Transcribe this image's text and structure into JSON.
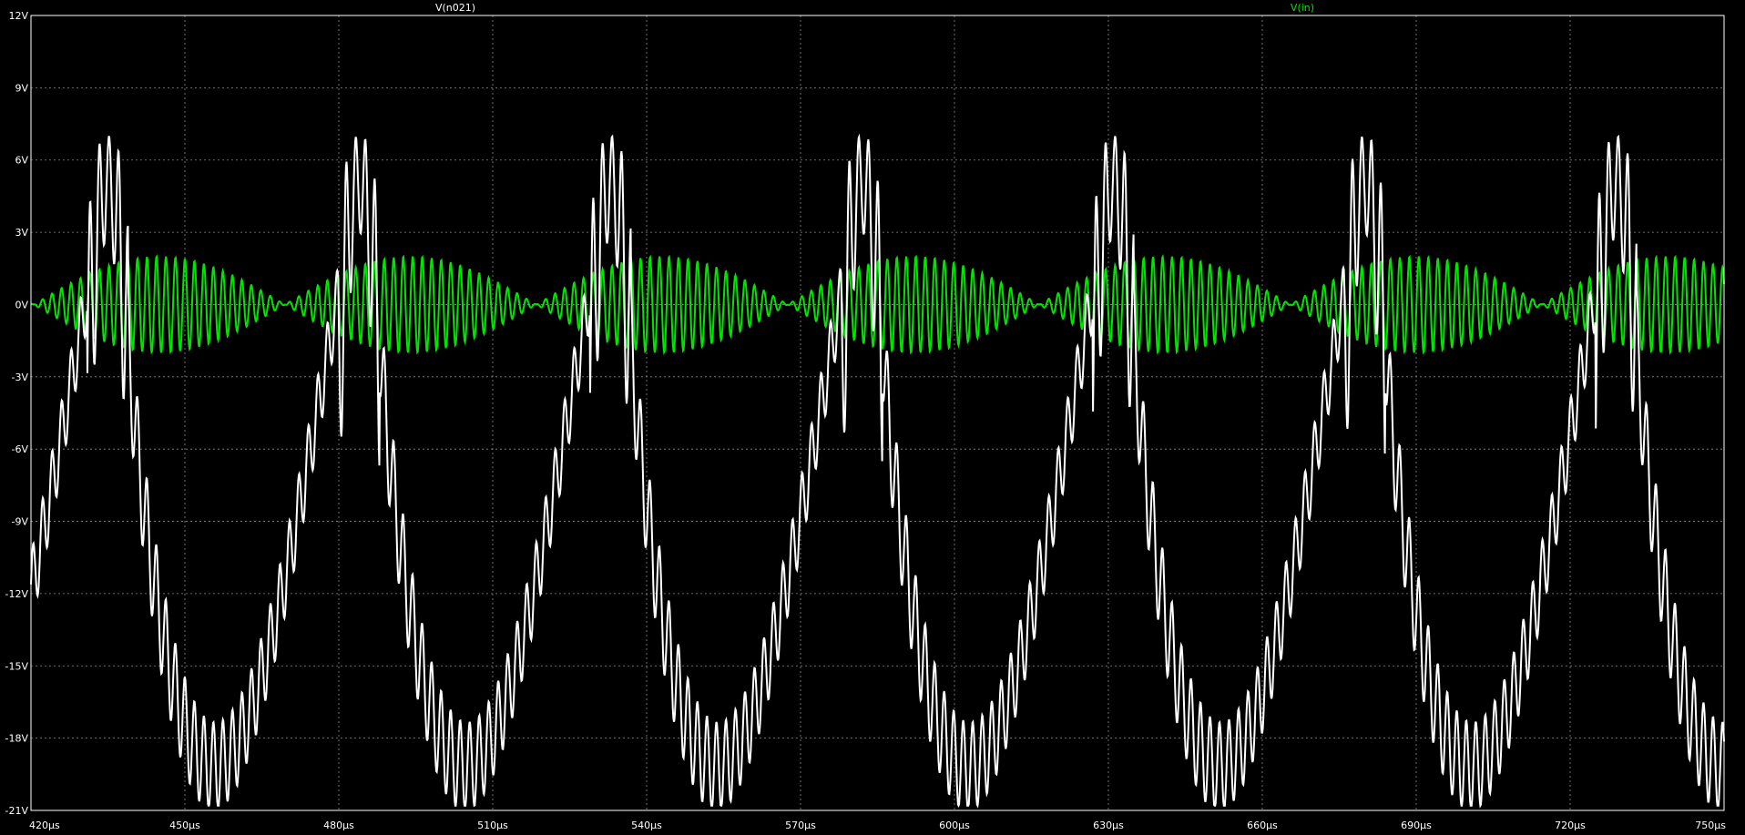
{
  "window": {
    "background": "#000000"
  },
  "chart_data": {
    "type": "line",
    "title": "",
    "xlabel": "",
    "ylabel": "",
    "x_unit": "µs",
    "y_unit": "V",
    "xlim": [
      420,
      750
    ],
    "ylim": [
      -21,
      12
    ],
    "x_ticks": [
      "420µs",
      "450µs",
      "480µs",
      "510µs",
      "540µs",
      "570µs",
      "600µs",
      "630µs",
      "660µs",
      "690µs",
      "720µs",
      "750µs"
    ],
    "y_ticks": [
      "12V",
      "9V",
      "6V",
      "3V",
      "0V",
      "-3V",
      "-6V",
      "-9V",
      "-12V",
      "-15V",
      "-18V",
      "-21V"
    ],
    "grid": true,
    "series": [
      {
        "name": "V(n021)",
        "color": "#ffffff",
        "description_points": {
          "period_us": 49,
          "peak_max_V": 9.6,
          "trough_min_V": -20.8,
          "peak_times_us": [
            431,
            482,
            531,
            580,
            630,
            680,
            729
          ],
          "trough_times_us": [
            451,
            500,
            550,
            599,
            649,
            699,
            748
          ]
        }
      },
      {
        "name": "V(in)",
        "color": "#00e400",
        "description_points": {
          "envelope_amplitude_V": 2.0,
          "envelope_period_us": 49,
          "envelope_null_times_us": [
            420.5,
            469.5,
            519,
            568.5,
            618,
            667.5,
            717
          ],
          "carrier_period_us": 1.85
        }
      }
    ]
  }
}
